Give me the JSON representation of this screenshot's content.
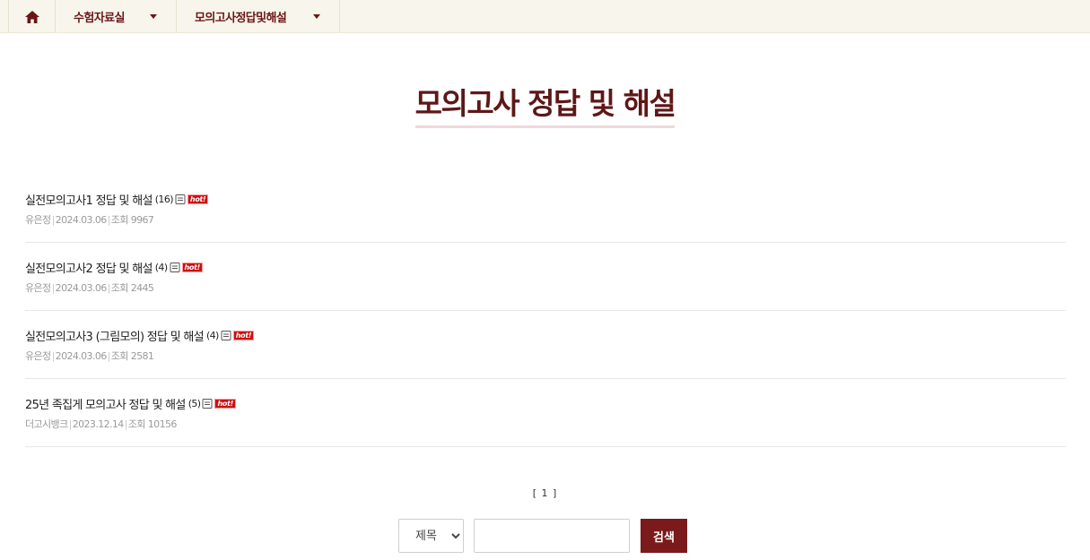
{
  "nav": {
    "home_icon": "home-icon",
    "menus": [
      {
        "label": "수험자료실",
        "icon": "caret-down-icon"
      },
      {
        "label": "모의고사정답및해설",
        "icon": "caret-down-icon"
      }
    ]
  },
  "page": {
    "title": "모의고사 정답 및 해설"
  },
  "posts": [
    {
      "title": "실전모의고사1 정답 및 해설",
      "comment_count": "(16)",
      "author": "유은정",
      "date": "2024.03.06",
      "views_label": "조회",
      "views": "9967",
      "hot": "hot!"
    },
    {
      "title": "실전모의고사2 정답 및 해설",
      "comment_count": "(4)",
      "author": "유은정",
      "date": "2024.03.06",
      "views_label": "조회",
      "views": "2445",
      "hot": "hot!"
    },
    {
      "title": "실전모의고사3 (그림모의) 정답 및 해설",
      "comment_count": "(4)",
      "author": "유은정",
      "date": "2024.03.06",
      "views_label": "조회",
      "views": "2581",
      "hot": "hot!"
    },
    {
      "title": "25년 족집게 모의고사 정답 및 해설",
      "comment_count": "(5)",
      "author": "더고시뱅크",
      "date": "2023.12.14",
      "views_label": "조회",
      "views": "10156",
      "hot": "hot!"
    }
  ],
  "pagination": {
    "text": "[ 1 ]"
  },
  "search": {
    "select_options": [
      "제목"
    ],
    "selected": "제목",
    "input_value": "",
    "button_label": "검색"
  },
  "colors": {
    "accent": "#6b1616",
    "nav_bg": "#f8f6ec",
    "button_bg": "#7a1a1a",
    "hot_badge": "#cc1010"
  }
}
